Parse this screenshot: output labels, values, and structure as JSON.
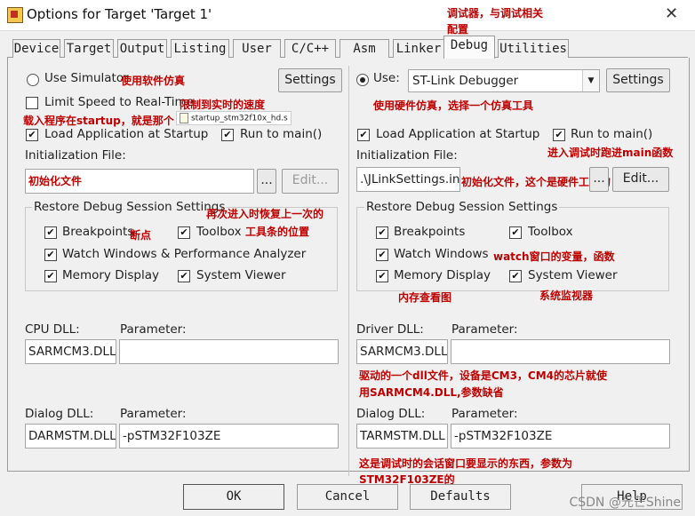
{
  "window": {
    "title": "Options for Target 'Target 1'",
    "close": "✕"
  },
  "tabs": [
    "Device",
    "Target",
    "Output",
    "Listing",
    "User",
    "C/C++",
    "Asm",
    "Linker",
    "Debug",
    "Utilities"
  ],
  "active_tab": "Debug",
  "left": {
    "use_simulator_label": "Use Simulator",
    "use_simulator_checked": false,
    "settings_button": "Settings",
    "limit_speed_label": "Limit Speed to Real-Time",
    "limit_speed_checked": false,
    "load_app_label": "Load Application at Startup",
    "load_app_checked": true,
    "run_to_main_label": "Run to main()",
    "run_to_main_checked": true,
    "init_file_label": "Initialization File:",
    "init_file_value": "初始化文件",
    "browse_button": "...",
    "edit_button": "Edit...",
    "restore_group_title": "Restore Debug Session Settings",
    "breakpoints_label": "Breakpoints",
    "toolbox_label": "Toolbox",
    "watch_label": "Watch Windows & Performance Analyzer",
    "memory_label": "Memory Display",
    "sysviewer_label": "System Viewer",
    "cpu_dll_label": "CPU DLL:",
    "cpu_dll_value": "SARMCM3.DLL",
    "cpu_param_label": "Parameter:",
    "cpu_param_value": "",
    "dialog_dll_label": "Dialog DLL:",
    "dialog_dll_value": "DARMSTM.DLL",
    "dialog_param_label": "Parameter:",
    "dialog_param_value": "-pSTM32F103ZE"
  },
  "right": {
    "use_label": "Use:",
    "use_checked": true,
    "debugger_value": "ST-Link Debugger",
    "settings_button": "Settings",
    "load_app_label": "Load Application at Startup",
    "load_app_checked": true,
    "run_to_main_label": "Run to main()",
    "run_to_main_checked": true,
    "init_file_label": "Initialization File:",
    "init_file_value": ".\\JLinkSettings.ini",
    "browse_button": "...",
    "edit_button": "Edit...",
    "restore_group_title": "Restore Debug Session Settings",
    "breakpoints_label": "Breakpoints",
    "toolbox_label": "Toolbox",
    "watch_label": "Watch Windows",
    "memory_label": "Memory Display",
    "sysviewer_label": "System Viewer",
    "driver_dll_label": "Driver DLL:",
    "driver_dll_value": "SARMCM3.DLL",
    "driver_param_label": "Parameter:",
    "driver_param_value": "",
    "dialog_dll_label": "Dialog DLL:",
    "dialog_dll_value": "TARMSTM.DLL",
    "dialog_param_label": "Parameter:",
    "dialog_param_value": "-pSTM32F103ZE"
  },
  "annotations": {
    "debug_tab_1": "调试器，与调试相关",
    "debug_tab_2": "配置",
    "simulator": "使用软件仿真",
    "limit_speed": "限制到实时的速度",
    "load_program": "载入程序在startup，就是那个",
    "startup_file": "startup_stm32f10x_hd.s",
    "hardware": "使用硬件仿真，选择一个仿真工具",
    "run_main": "进入调试时跑进main函数",
    "hw_init": "初始化文件，这个是硬件工具的",
    "restore": "再次进入时恢复上一次的",
    "breakpoints": "断点",
    "toolbox": "工具条的位置",
    "watch": "watch窗口的变量，函数",
    "memory": "内存查看图",
    "sysviewer": "系统监视器",
    "driver_1": "驱动的一个dll文件，设备是CM3，CM4的芯片就使",
    "driver_2": "用SARMCM4.DLL,参数缺省",
    "dialog_1": "这是调试时的会话窗口要显示的东西，参数为",
    "dialog_2": "STM32F103ZE的"
  },
  "footer": {
    "ok": "OK",
    "cancel": "Cancel",
    "defaults": "Defaults",
    "help": "Help"
  },
  "watermark": "CSDN @光芒Shine"
}
